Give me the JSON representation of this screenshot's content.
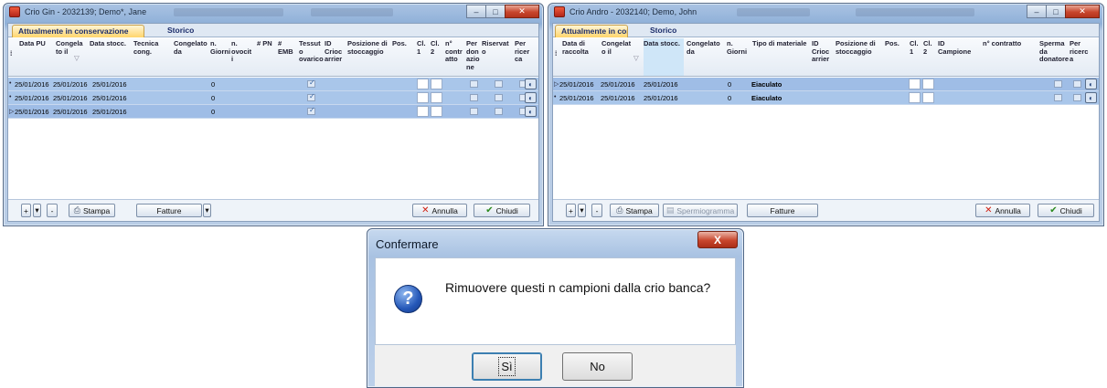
{
  "left_window": {
    "title": "Crio Gin - 2032139; Demo*, Jane",
    "tabs": [
      "Attualmente in conservazione",
      "Storico"
    ],
    "columns": [
      "Data PU",
      "Congela\nto il",
      "Data stocc.",
      "Tecnica\ncong.",
      "Congelato\nda",
      "n.\nGiorni",
      "n.\novocit\ni",
      "# PN",
      "#\nEMB",
      "Tessut\no\novarico",
      "ID\nCrioc\narrier",
      "Posizione di\nstoccaggio",
      "Pos.",
      "Cl.\n1",
      "Cl.\n2",
      "n°\ncontr\natto",
      "Per\ndon\nazio\nne",
      "Riservat\no",
      "Per\nricer\nca"
    ],
    "rows": [
      {
        "marker": "•",
        "data_pu": "25/01/2016",
        "congelato_il": "25/01/2016",
        "data_stocc": "25/01/2016",
        "giorni": "0"
      },
      {
        "marker": "•",
        "data_pu": "25/01/2016",
        "congelato_il": "25/01/2016",
        "data_stocc": "25/01/2016",
        "giorni": "0"
      },
      {
        "marker": "▷",
        "data_pu": "25/01/2016",
        "congelato_il": "25/01/2016",
        "data_stocc": "25/01/2016",
        "giorni": "0"
      }
    ],
    "footer": {
      "plus": "+",
      "minus": "-",
      "print": "Stampa",
      "invoices": "Fatture",
      "cancel": "Annulla",
      "close": "Chiudi"
    }
  },
  "right_window": {
    "title": "Crio Andro - 2032140; Demo, John",
    "tabs": [
      "Attualmente in con...",
      "Storico"
    ],
    "columns": [
      "Data di\nraccolta",
      "Congelat\no il",
      "Data stocc.",
      "Congelato\nda",
      "n.\nGiorni",
      "Tipo di materiale",
      "ID\nCrioc\narrier",
      "Posizione di\nstoccaggio",
      "Pos.",
      "Cl.\n1",
      "Cl.\n2",
      "ID\nCampione",
      "n° contratto",
      "Sperma\nda\ndonatore",
      "Per\nricerc\na"
    ],
    "rows": [
      {
        "marker": "▷",
        "data_raccolta": "25/01/2016",
        "congelato_il": "25/01/2016",
        "data_stocc": "25/01/2016",
        "giorni": "0",
        "tipo": "Eiaculato"
      },
      {
        "marker": "•",
        "data_raccolta": "25/01/2016",
        "congelato_il": "25/01/2016",
        "data_stocc": "25/01/2016",
        "giorni": "0",
        "tipo": "Eiaculato"
      }
    ],
    "footer": {
      "plus": "+",
      "minus": "-",
      "print": "Stampa",
      "spermiogram": "Spermiogramma",
      "invoices": "Fatture",
      "cancel": "Annulla",
      "close": "Chiudi"
    }
  },
  "dialog": {
    "title": "Confermare",
    "close": "X",
    "message": "Rimuovere questi n campioni dalla crio banca?",
    "yes": "Sì",
    "no": "No"
  }
}
